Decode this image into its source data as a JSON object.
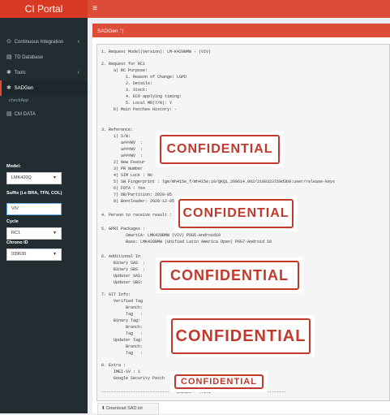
{
  "app": {
    "title": "CI Portal",
    "menu_icon": "hamburger-icon"
  },
  "sidebar": {
    "items": [
      {
        "icon": "dashboard-icon",
        "glyph": "⊙",
        "label": "Continuous Integration",
        "chevron": "‹"
      },
      {
        "icon": "database-icon",
        "glyph": "▤",
        "label": "TD Database"
      },
      {
        "icon": "wrench-icon",
        "glyph": "✱",
        "label": "Tools",
        "chevron": "‹"
      },
      {
        "icon": "gears-icon",
        "glyph": "✱",
        "label": "SADGen"
      },
      {
        "label": "checkApp"
      },
      {
        "icon": "database-icon",
        "glyph": "▤",
        "label": "CM DATA"
      }
    ]
  },
  "form": {
    "model": {
      "label": "Model:",
      "value": "LMK420Q"
    },
    "suffix": {
      "label": "Suffix (i.e BRA, TFN, COL)",
      "value": "VIV"
    },
    "cycle": {
      "label": "Cycle",
      "value": "RC1"
    },
    "chrono": {
      "label": "Chrono ID",
      "value": "039630"
    }
  },
  "main": {
    "header": "SADGen :'(",
    "lines": [
      "1. Request Model(Version): LM-K420BMW - (VIV)",
      "2. Request for RC1",
      "     a) RC Purpose:",
      "          1. Reason of Change: LGPD",
      "          2. Details:",
      "          3. Stock:",
      "          4. ECO applying timing:",
      "          5. Local MR(Y/N): Y",
      "     b) Main Patches History: -",
      "3. Reference:",
      "     1) S/W:",
      "        a###WV  :",
      "        a###WV  :",
      "        a###WV  :",
      "     2) New Featur",
      "     3) PR Number",
      "     4) SIM Lock : No",
      "     5) SW Fingerprint : lge/mh415e_f/mh415e:10/QKQ1.200614.002/2108323l59d3b9:user/release-keys",
      "     6) FOTA : Yes",
      "     7) DB/Partition: 2020-05",
      "     8) Bootloader: 2020-12-05",
      "4. Person to receive result :",
      "5. GPRI Packages :",
      "          SmartCA: LMK420BMW (VIV) P6G5-Android10",
      "          Base: LMK420BMW (Unified Latin America Open) P6G7-Android 10",
      "6. Additional In",
      "     Binary SAS  :",
      "     Binary SBS  :",
      "     Updater SAS:",
      "     Updater SBS:",
      "7. GIT Info:",
      "     Verified Tag",
      "          Branch:",
      "          Tag   :",
      "     Binary Tag:",
      "          Branch:",
      "          Tag   :",
      "     Updater Tag:",
      "          Branch:",
      "          Tag   :",
      "8. Extra :",
      "     IMEI-SV : 1",
      "     Google Security Patch",
      "------------------------------ SADGEN - 4.1.1 ------------------------------"
    ],
    "stamp_text": "CONFIDENTIAL",
    "download_label": "Download SAD.txt"
  },
  "colors": {
    "accent": "#dd4b39",
    "sidebar": "#222d32",
    "stamp": "#c0392b"
  }
}
